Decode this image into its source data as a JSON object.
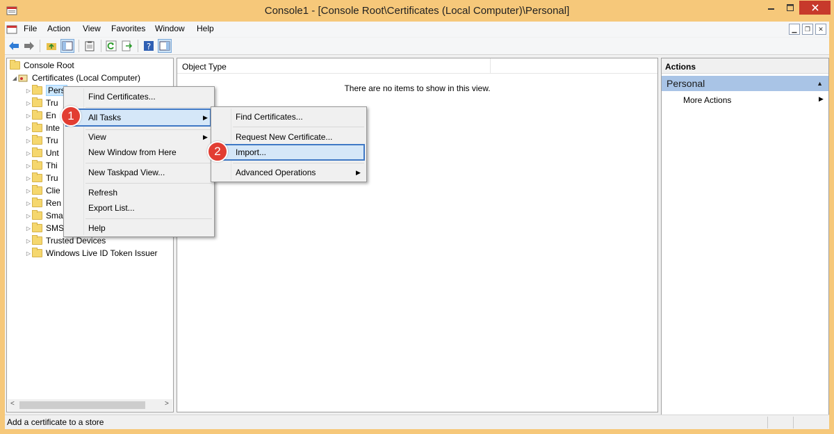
{
  "window": {
    "title": "Console1 - [Console Root\\Certificates (Local Computer)\\Personal]"
  },
  "menubar": {
    "items": [
      "File",
      "Action",
      "View",
      "Favorites",
      "Window",
      "Help"
    ]
  },
  "tree": {
    "root": "Console Root",
    "certificates": "Certificates (Local Computer)",
    "folders": [
      "Pers",
      "Tru",
      "En",
      "Inte",
      "Tru",
      "Unt",
      "Thi",
      "Tru",
      "Clie",
      "Ren",
      "Sma",
      "SMS",
      "Trusted Devices",
      "Windows Live ID Token Issuer"
    ]
  },
  "center": {
    "column_header": "Object Type",
    "empty_message": "There are no items to show in this view."
  },
  "actions": {
    "header": "Actions",
    "section": "Personal",
    "more_actions": "More Actions"
  },
  "status": {
    "text": "Add a certificate to a store"
  },
  "context_menu": {
    "find": "Find Certificates...",
    "all_tasks": "All Tasks",
    "view": "View",
    "new_window": "New Window from Here",
    "new_taskpad": "New Taskpad View...",
    "refresh": "Refresh",
    "export": "Export List...",
    "help": "Help"
  },
  "submenu": {
    "find": "Find Certificates...",
    "request": "Request New Certificate...",
    "import": "Import...",
    "advanced": "Advanced Operations"
  },
  "badges": {
    "step1": "1",
    "step2": "2"
  },
  "colors": {
    "frame": "#f6c87a",
    "close": "#c7392b",
    "highlight_border": "#3f78c5",
    "badge": "#e23d32",
    "actions_section": "#a9c4e6"
  }
}
